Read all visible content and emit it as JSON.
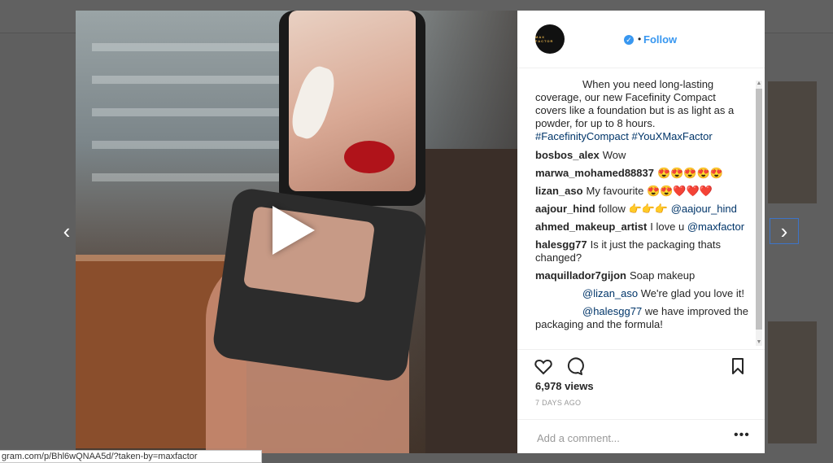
{
  "navigation": {
    "prev_arrow": "‹",
    "next_arrow": "›"
  },
  "post": {
    "account_logo_text": "MAX FACTOR",
    "follow_label": "Follow",
    "dot_separator": "•",
    "caption_text": "When you need long-lasting coverage, our new Facefinity Compact covers like a foundation but is as light as a powder, for up to 8 hours.",
    "caption_hashtags": "#FacefinityCompact #YouXMaxFactor",
    "comments": [
      {
        "user": "bosbos_alex",
        "text": "Wow"
      },
      {
        "user": "marwa_mohamed88837",
        "text": "😍😍😍😍😍"
      },
      {
        "user": "lizan_aso",
        "text": "My favourite 😍😍❤️❤️❤️"
      },
      {
        "user": "aajour_hind",
        "text": "follow 👉👉👉",
        "mention": "@aajour_hind"
      },
      {
        "user": "ahmed_makeup_artist",
        "text": "I love u",
        "mention": "@maxfactor"
      },
      {
        "user": "halesgg77",
        "text": "Is it just the packaging thats changed?"
      },
      {
        "user": "maquillador7gijon",
        "text": "Soap makeup"
      }
    ],
    "replies": [
      {
        "mention": "@lizan_aso",
        "text": "We're glad you love it!"
      },
      {
        "mention": "@halesgg77",
        "text": "we have improved the packaging and the formula!"
      }
    ],
    "views": "6,978 views",
    "time_ago": "7 DAYS AGO",
    "add_comment_placeholder": "Add a comment...",
    "more_label": "•••"
  },
  "status_bar": {
    "url": "gram.com/p/Bhl6wQNAA5d/?taken-by=maxfactor"
  },
  "icons": {
    "heart": "heart-icon",
    "comment": "comment-icon",
    "bookmark": "bookmark-icon",
    "play": "play-icon",
    "verified": "verified-badge-icon"
  },
  "colors": {
    "link_blue": "#3897f0",
    "hashtag": "#003569",
    "overlay": "rgba(0,0,0,0.62)"
  }
}
